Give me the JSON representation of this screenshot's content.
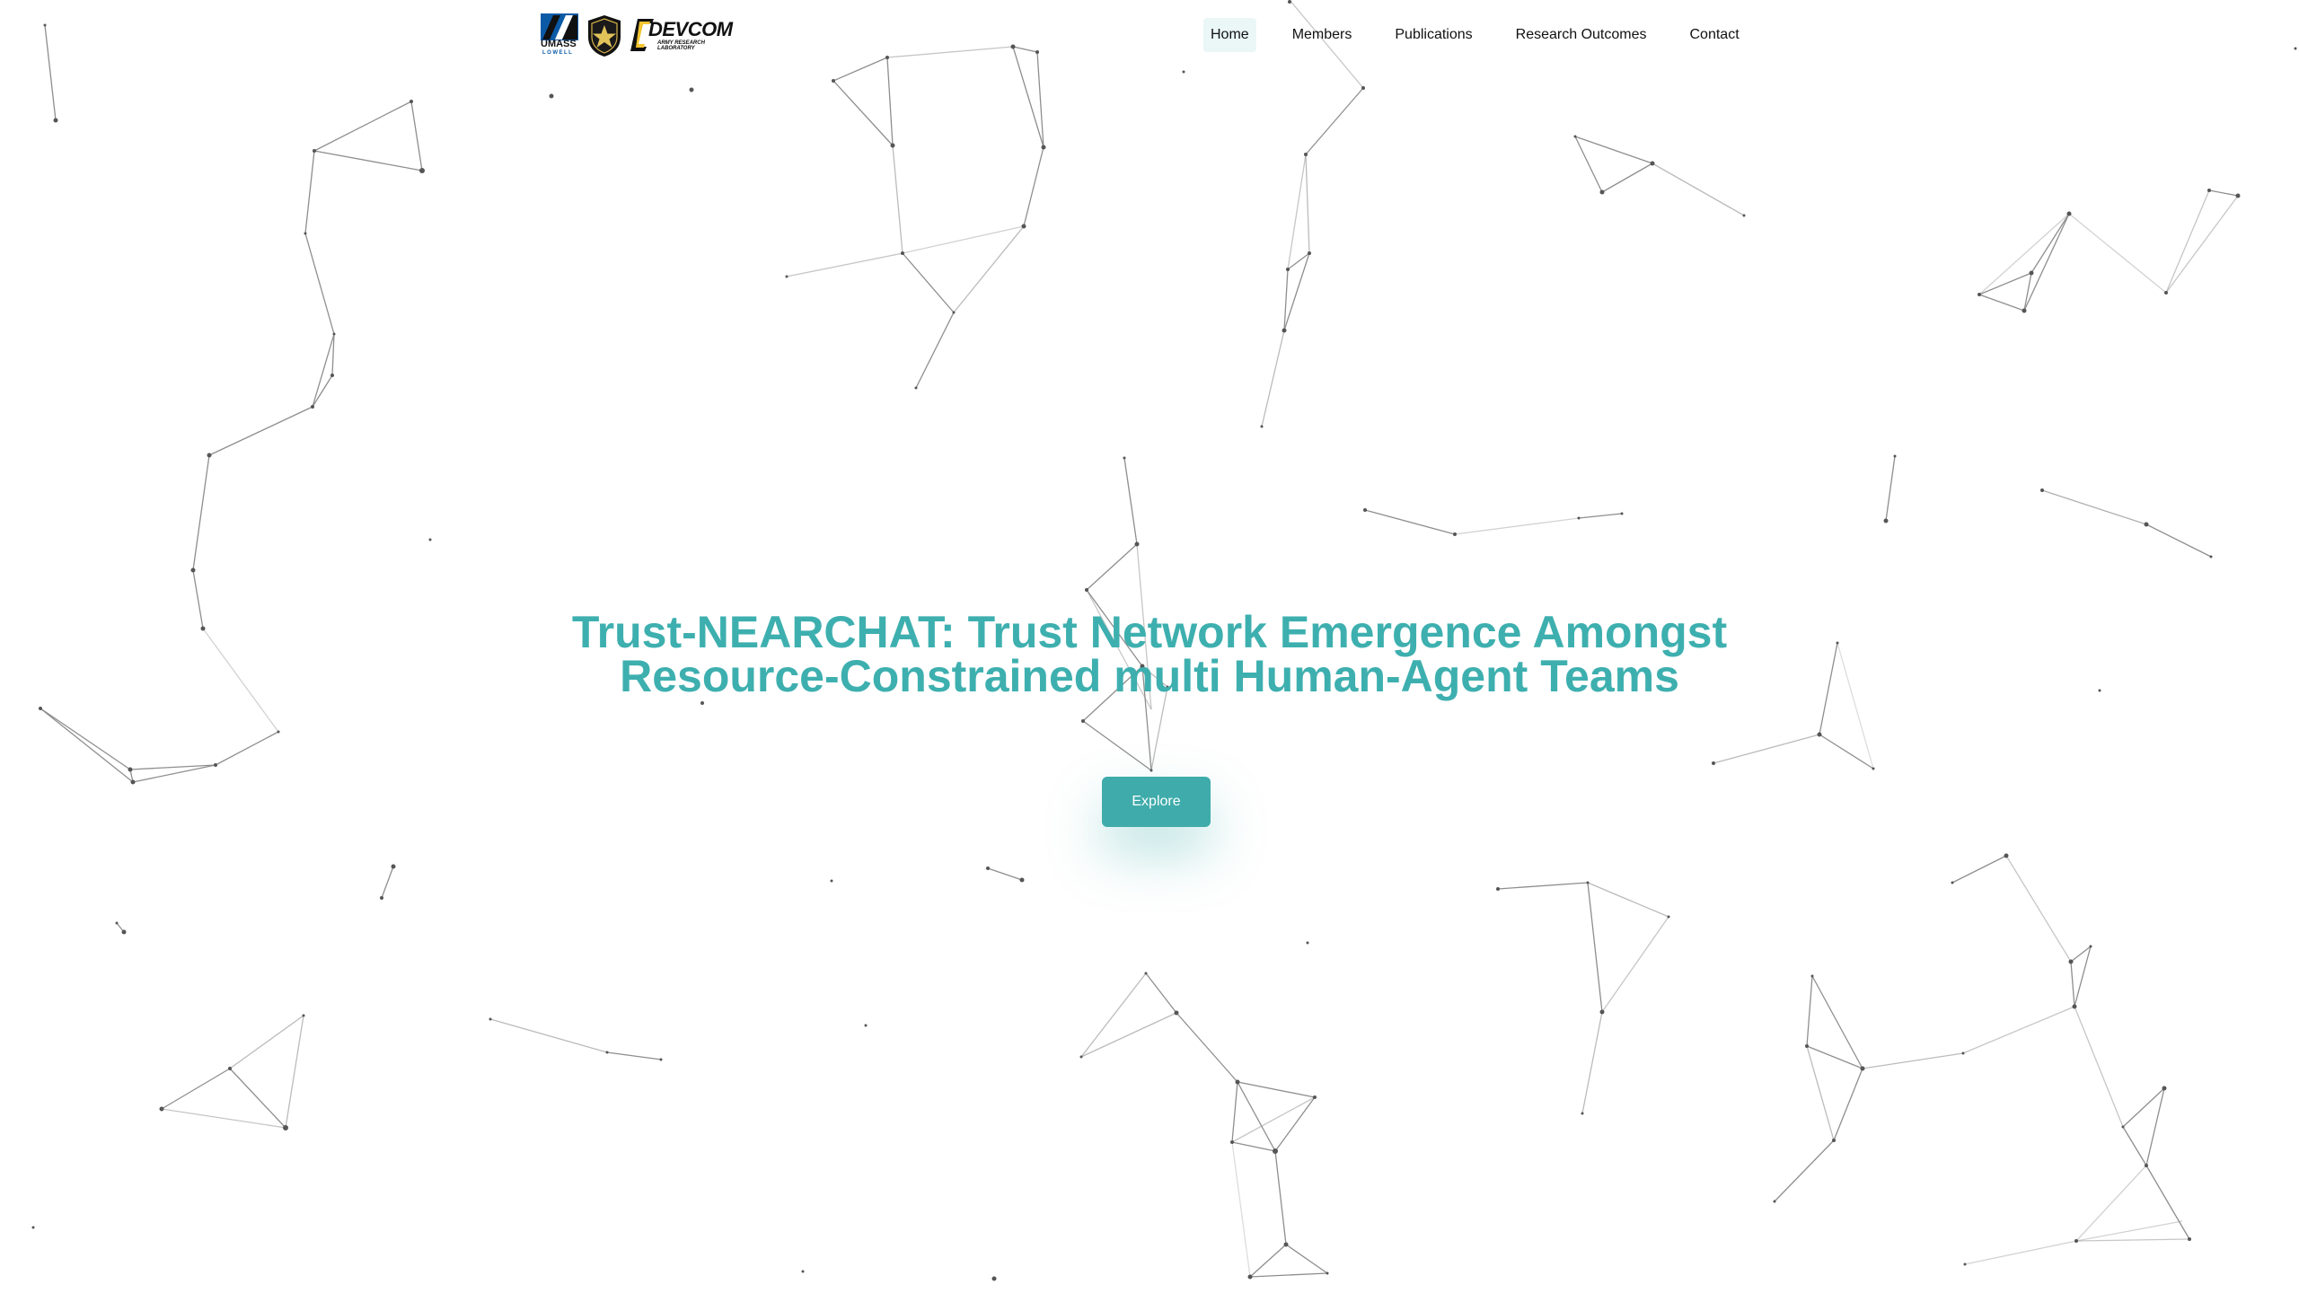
{
  "logos": {
    "umass": {
      "word": "UMASS",
      "sub": "LOWELL"
    },
    "arl": {
      "icon": "arl-star-shield-icon"
    },
    "devcom": {
      "word": "DEVCOM",
      "sub": "ARMY RESEARCH LABORATORY"
    }
  },
  "nav": {
    "items": [
      {
        "label": "Home",
        "active": true
      },
      {
        "label": "Members",
        "active": false
      },
      {
        "label": "Publications",
        "active": false
      },
      {
        "label": "Research Outcomes",
        "active": false
      },
      {
        "label": "Contact",
        "active": false
      }
    ]
  },
  "hero": {
    "title": "Trust-NEARCHAT: Trust Network Emergence Amongst Resource-Constrained multi Human-Agent Teams",
    "button_label": "Explore"
  },
  "colors": {
    "accent": "#3eafaf",
    "button": "#3fabab",
    "active_nav_bg": "#eaf7f6",
    "network_node": "#555555",
    "network_edge": "#888888"
  }
}
